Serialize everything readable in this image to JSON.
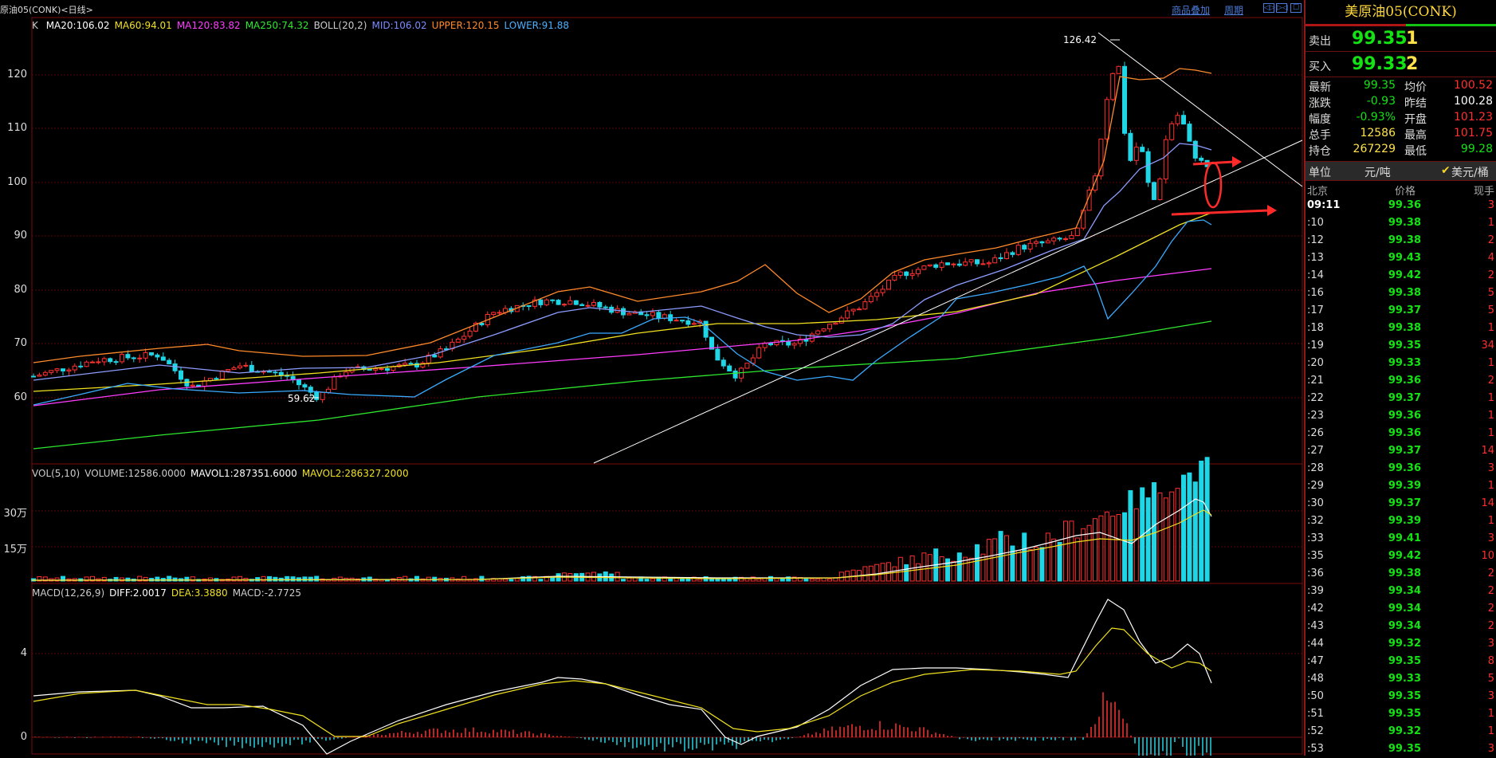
{
  "window": {
    "title": "原油05(CONK)<日线>",
    "links": [
      "商品叠加",
      "周期"
    ],
    "button_glyphs": [
      "◁▷",
      "▷◁"
    ]
  },
  "price_panel": {
    "indicator_prefix": "K",
    "indicators": [
      {
        "text": "MA20:106.02",
        "color": "#ffffff"
      },
      {
        "text": "MA60:94.01",
        "color": "#f0e020"
      },
      {
        "text": "MA120:83.82",
        "color": "#ff3cff"
      },
      {
        "text": "MA250:74.32",
        "color": "#2ee82e"
      },
      {
        "text": "BOLL(20,2)",
        "color": "#cccccc"
      },
      {
        "text": "MID:106.02",
        "color": "#7a8cff"
      },
      {
        "text": "UPPER:120.15",
        "color": "#ff8a2a"
      },
      {
        "text": "LOWER:91.88",
        "color": "#4ab0ff"
      }
    ],
    "y_labels": [
      "120",
      "110",
      "100",
      "90",
      "80",
      "70",
      "60"
    ],
    "high_label": "126.42",
    "low_label": "59.62"
  },
  "volume_panel": {
    "indicators": [
      {
        "text": "VOL(5,10)",
        "color": "#cccccc"
      },
      {
        "text": "VOLUME:12586.0000",
        "color": "#cccccc"
      },
      {
        "text": "MAVOL1:287351.6000",
        "color": "#ffffff"
      },
      {
        "text": "MAVOL2:286327.2000",
        "color": "#f0e020"
      }
    ],
    "y_labels": [
      "30万",
      "15万"
    ]
  },
  "macd_panel": {
    "indicators": [
      {
        "text": "MACD(12,26,9)",
        "color": "#cccccc"
      },
      {
        "text": "DIFF:2.0017",
        "color": "#ffffff"
      },
      {
        "text": "DEA:3.3880",
        "color": "#f0e020"
      },
      {
        "text": "MACD:-2.7725",
        "color": "#cccccc"
      }
    ],
    "y_labels": [
      "4",
      "0"
    ]
  },
  "quote_panel": {
    "title": "美原油05(CONK)",
    "sell": {
      "label": "卖出",
      "price": "99.35",
      "volume": "1"
    },
    "buy": {
      "label": "买入",
      "price": "99.33",
      "volume": "2"
    },
    "stats": [
      {
        "label": "最新",
        "value": "99.35",
        "color": "#13e213",
        "label2": "均价",
        "value2": "100.52",
        "color2": "#ff3030"
      },
      {
        "label": "涨跌",
        "value": "-0.93",
        "color": "#13e213",
        "label2": "昨结",
        "value2": "100.28",
        "color2": "#ffffff"
      },
      {
        "label": "幅度",
        "value": "-0.93%",
        "color": "#13e213",
        "label2": "开盘",
        "value2": "101.23",
        "color2": "#ff3030"
      },
      {
        "label": "总手",
        "value": "12586",
        "color": "#ffe24b",
        "label2": "最高",
        "value2": "101.75",
        "color2": "#ff3030"
      },
      {
        "label": "持仓",
        "value": "267229",
        "color": "#ffe24b",
        "label2": "最低",
        "value2": "99.28",
        "color2": "#13e213"
      }
    ],
    "unit": {
      "label": "单位",
      "option1": "元/吨",
      "option2": "美元/桶",
      "check": "✔"
    },
    "ticks_header": {
      "time": "北京",
      "price": "价格",
      "volume": "现手"
    },
    "ticks": [
      {
        "time": "09:11",
        "price": "99.36",
        "volume": "3"
      },
      {
        "time": ":10",
        "price": "99.38",
        "volume": "1"
      },
      {
        "time": ":12",
        "price": "99.38",
        "volume": "2"
      },
      {
        "time": ":13",
        "price": "99.43",
        "volume": "4"
      },
      {
        "time": ":14",
        "price": "99.42",
        "volume": "2"
      },
      {
        "time": ":16",
        "price": "99.38",
        "volume": "5"
      },
      {
        "time": ":17",
        "price": "99.37",
        "volume": "5"
      },
      {
        "time": ":18",
        "price": "99.38",
        "volume": "1"
      },
      {
        "time": ":19",
        "price": "99.35",
        "volume": "34"
      },
      {
        "time": ":20",
        "price": "99.33",
        "volume": "1"
      },
      {
        "time": ":21",
        "price": "99.36",
        "volume": "2"
      },
      {
        "time": ":22",
        "price": "99.37",
        "volume": "1"
      },
      {
        "time": ":23",
        "price": "99.36",
        "volume": "1"
      },
      {
        "time": ":26",
        "price": "99.36",
        "volume": "1"
      },
      {
        "time": ":27",
        "price": "99.37",
        "volume": "14"
      },
      {
        "time": ":28",
        "price": "99.36",
        "volume": "3"
      },
      {
        "time": ":29",
        "price": "99.39",
        "volume": "1"
      },
      {
        "time": ":30",
        "price": "99.37",
        "volume": "14"
      },
      {
        "time": ":32",
        "price": "99.39",
        "volume": "1"
      },
      {
        "time": ":33",
        "price": "99.41",
        "volume": "3"
      },
      {
        "time": ":35",
        "price": "99.42",
        "volume": "10"
      },
      {
        "time": ":36",
        "price": "99.38",
        "volume": "2"
      },
      {
        "time": ":39",
        "price": "99.34",
        "volume": "2"
      },
      {
        "time": ":42",
        "price": "99.34",
        "volume": "2"
      },
      {
        "time": ":43",
        "price": "99.34",
        "volume": "2"
      },
      {
        "time": ":44",
        "price": "99.32",
        "volume": "3"
      },
      {
        "time": ":47",
        "price": "99.35",
        "volume": "8"
      },
      {
        "time": ":48",
        "price": "99.33",
        "volume": "5"
      },
      {
        "time": ":50",
        "price": "99.35",
        "volume": "3"
      },
      {
        "time": ":51",
        "price": "99.35",
        "volume": "1"
      },
      {
        "time": ":52",
        "price": "99.32",
        "volume": "1"
      },
      {
        "time": ":53",
        "price": "99.35",
        "volume": "3"
      }
    ]
  },
  "colors": {
    "up": "#ff3030",
    "down": "#1fd6e6",
    "grid": "#7a0e0e"
  }
}
